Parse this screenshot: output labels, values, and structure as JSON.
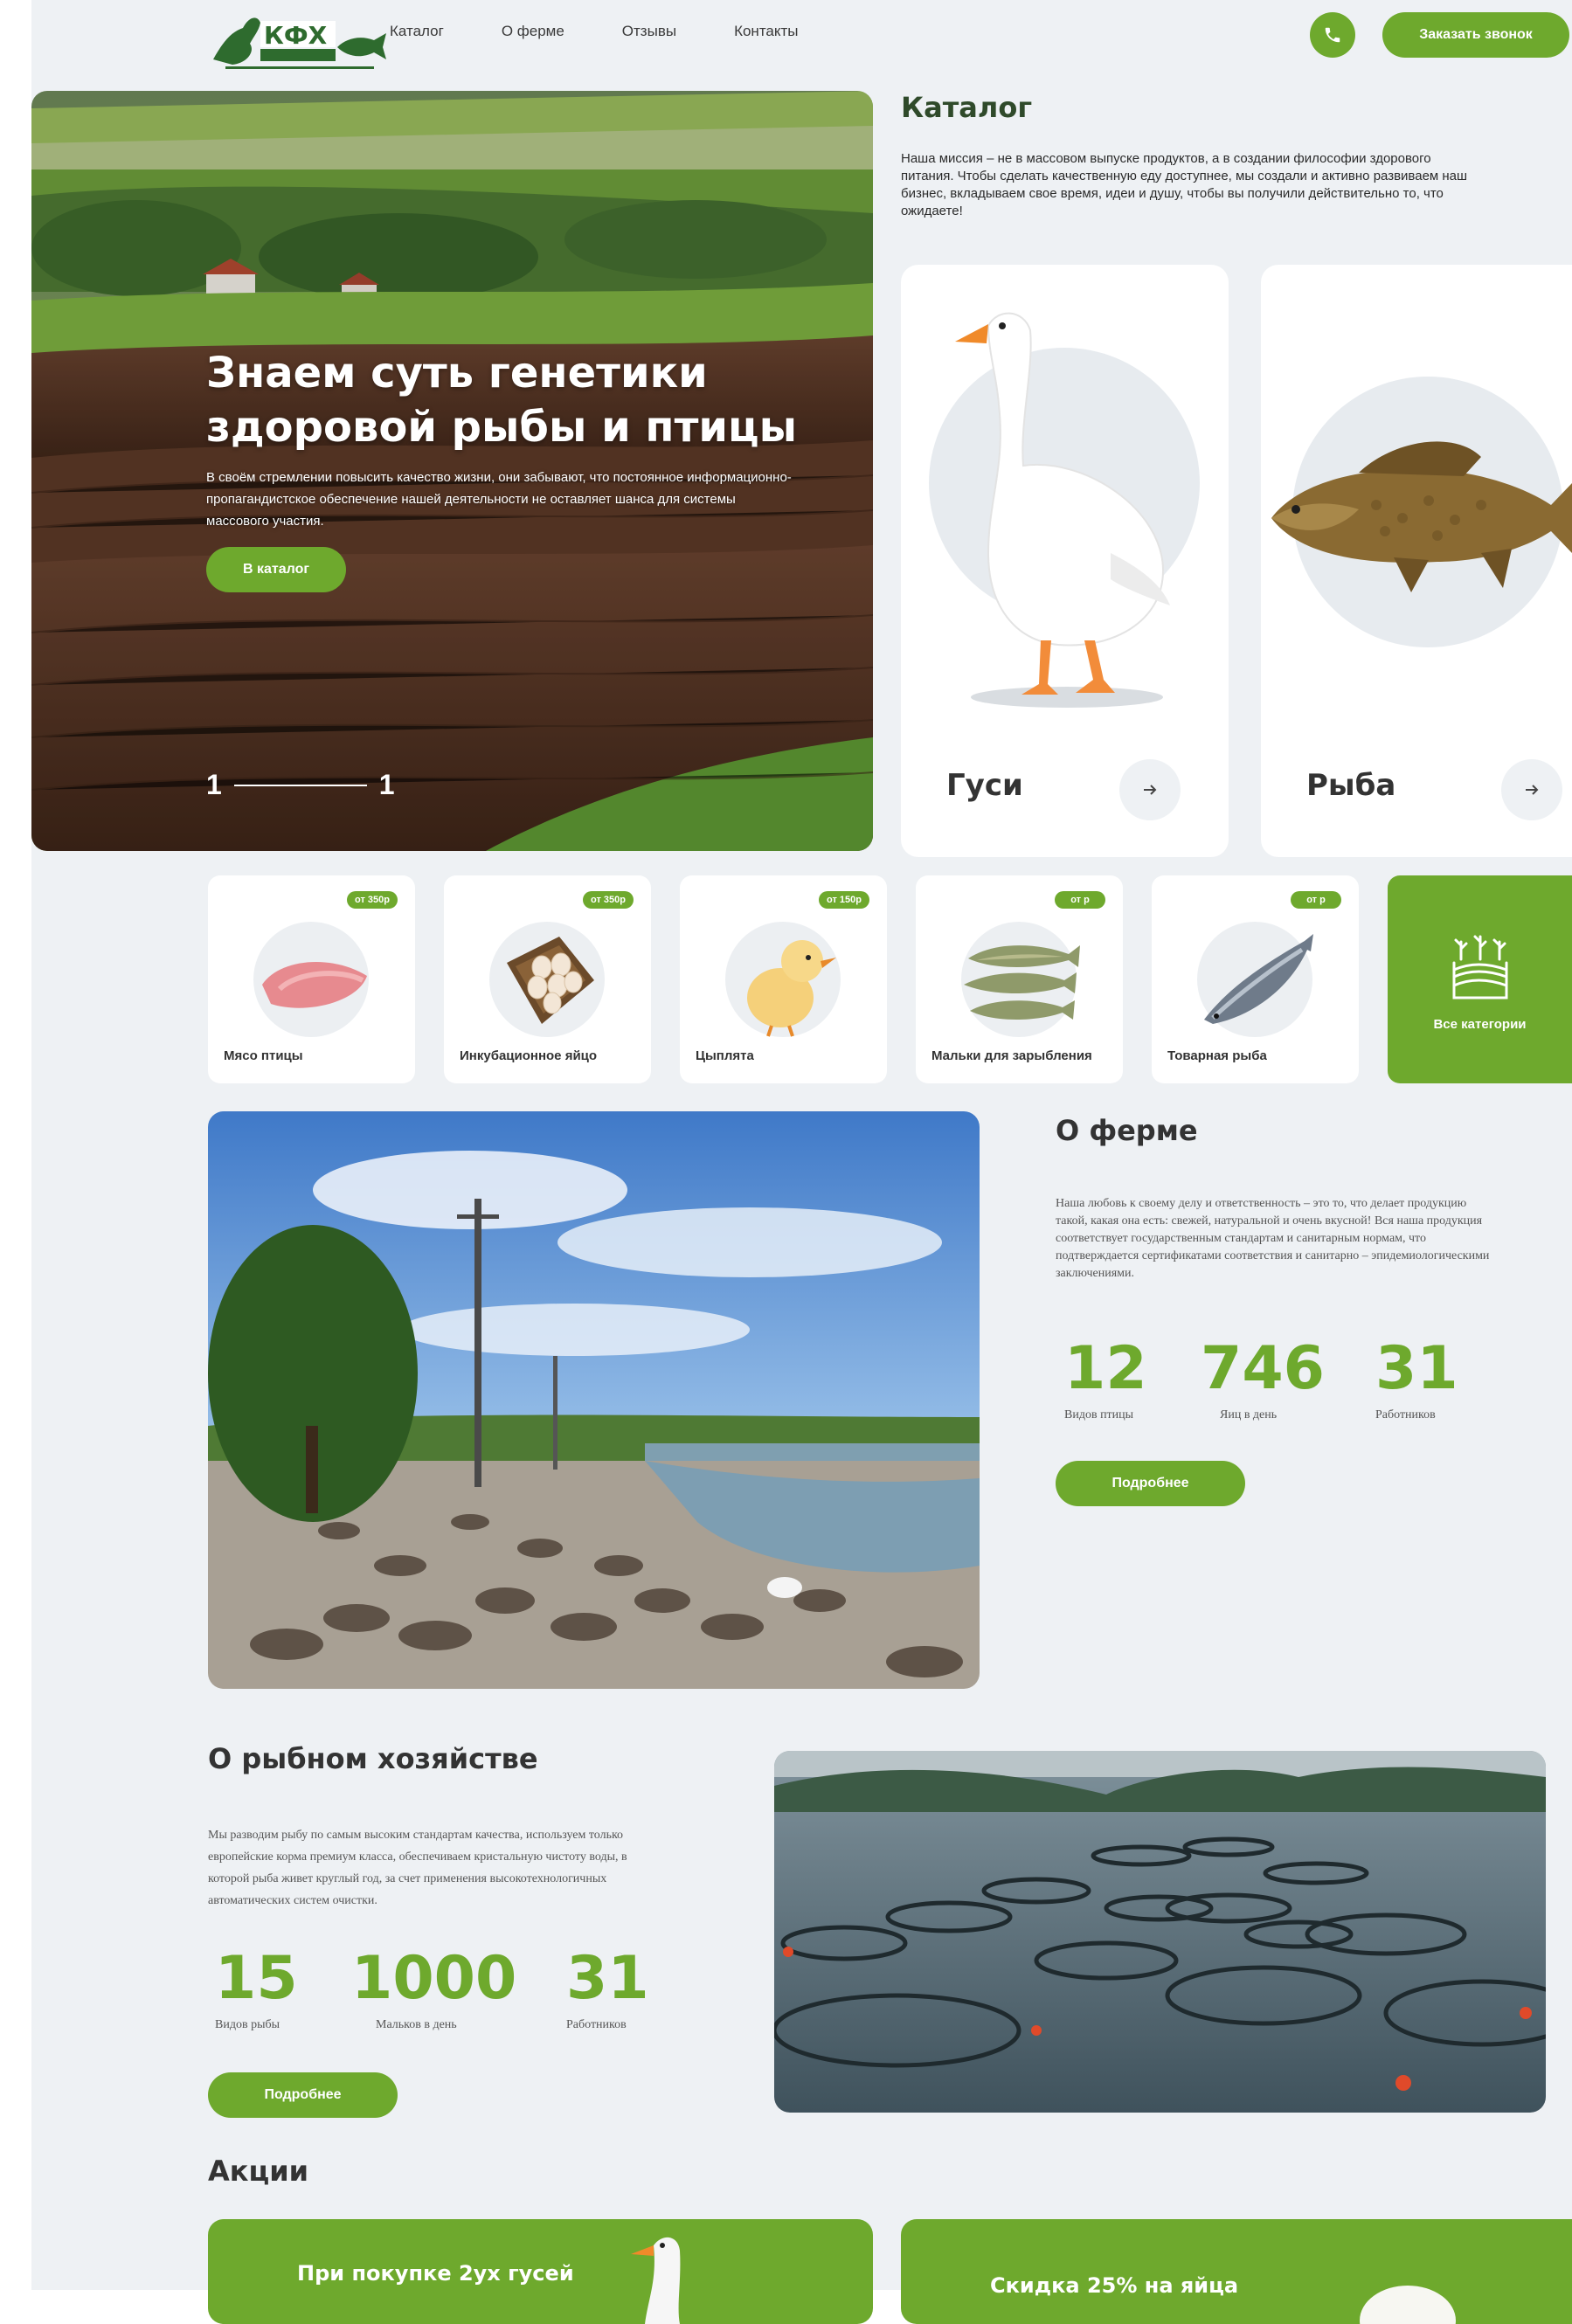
{
  "header": {
    "logo_text": "КФХ",
    "nav": [
      "Каталог",
      "О ферме",
      "Отзывы",
      "Контакты"
    ],
    "call_button": "Заказать звонок",
    "icons": {
      "phone": "phone-icon"
    }
  },
  "hero": {
    "title": "Знаем суть генетики здоровой рыбы и птицы",
    "text": "В своём стремлении повысить качество жизни, они забывают, что постоянное информационно-пропагандистское обеспечение нашей деятельности не оставляет шанса для системы массового участия.",
    "button": "В каталог",
    "slide_current": "1",
    "slide_total": "1"
  },
  "catalog": {
    "title": "Каталог",
    "text": "Наша миссия – не в массовом выпуске продуктов, а в создании философии здорового питания. Чтобы сделать качественную еду доступнее, мы создали и активно развиваем наш бизнес, вкладываем свое время, идеи и душу, чтобы вы получили действительно то, что ожидаете!",
    "cards": [
      {
        "name": "Гуси"
      },
      {
        "name": "Рыба"
      }
    ]
  },
  "categories": {
    "items": [
      {
        "label": "Мясо птицы",
        "badge": "от 350р"
      },
      {
        "label": "Инкубационное яйцо",
        "badge": "от 350р"
      },
      {
        "label": "Цыплята",
        "badge": "от 150р"
      },
      {
        "label": "Мальки для зарыбления",
        "badge": "от р"
      },
      {
        "label": "Товарная рыба",
        "badge": "от р"
      }
    ],
    "all_label": "Все категории"
  },
  "farm": {
    "title": "О ферме",
    "text": "Наша любовь к своему делу и ответственность – это то, что делает продукцию такой, какая она есть: свежей, натуральной и очень вкусной! Вся наша продукция соответствует государственным стандартам и санитарным нормам, что подтверждается сертификатами соответствия и санитарно – эпидемиологическими заключениями.",
    "stats": [
      {
        "value": "12",
        "label": "Видов птицы"
      },
      {
        "value": "746",
        "label": "Яиц в день"
      },
      {
        "value": "31",
        "label": "Работников"
      }
    ],
    "button": "Подробнее"
  },
  "fish": {
    "title": "О рыбном хозяйстве",
    "text": "Мы разводим рыбу по самым высоким стандартам качества, используем только европейские корма премиум класса, обеспечиваем кристальную чистоту воды, в которой рыба живет круглый год, за счет применения высокотехнологичных автоматических систем очистки.",
    "stats": [
      {
        "value": "15",
        "label": "Видов рыбы"
      },
      {
        "value": "1000",
        "label": "Мальков в день"
      },
      {
        "value": "31",
        "label": "Работников"
      }
    ],
    "button": "Подробнее"
  },
  "promos": {
    "title": "Акции",
    "items": [
      {
        "text": "При покупке 2ух гусей"
      },
      {
        "text": "Скидка 25% на яйца"
      }
    ]
  },
  "colors": {
    "accent": "#6ea92d",
    "page_bg": "#eef1f4",
    "heading_dark": "#2f4a2a"
  }
}
